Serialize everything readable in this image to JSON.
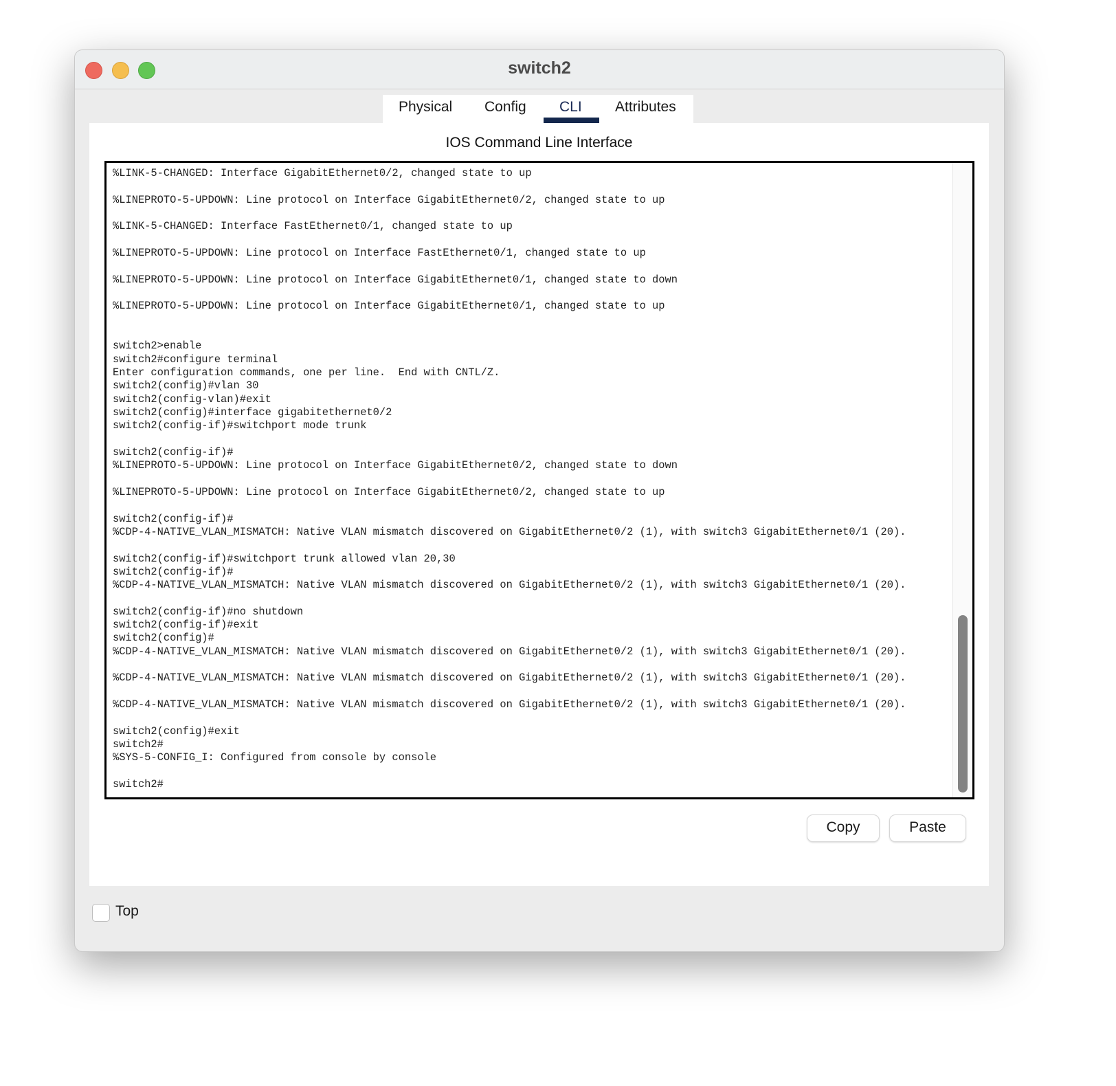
{
  "window": {
    "title": "switch2"
  },
  "tabs": [
    {
      "label": "Physical",
      "active": false
    },
    {
      "label": "Config",
      "active": false
    },
    {
      "label": "CLI",
      "active": true
    },
    {
      "label": "Attributes",
      "active": false
    }
  ],
  "accent_color": "#13274d",
  "cli": {
    "heading": "IOS Command Line Interface",
    "scroll_position_percent": 100,
    "lines": [
      "%LINK-5-CHANGED: Interface GigabitEthernet0/2, changed state to up",
      "",
      "%LINEPROTO-5-UPDOWN: Line protocol on Interface GigabitEthernet0/2, changed state to up",
      "",
      "%LINK-5-CHANGED: Interface FastEthernet0/1, changed state to up",
      "",
      "%LINEPROTO-5-UPDOWN: Line protocol on Interface FastEthernet0/1, changed state to up",
      "",
      "%LINEPROTO-5-UPDOWN: Line protocol on Interface GigabitEthernet0/1, changed state to down",
      "",
      "%LINEPROTO-5-UPDOWN: Line protocol on Interface GigabitEthernet0/1, changed state to up",
      "",
      "",
      "switch2>enable",
      "switch2#configure terminal",
      "Enter configuration commands, one per line.  End with CNTL/Z.",
      "switch2(config)#vlan 30",
      "switch2(config-vlan)#exit",
      "switch2(config)#interface gigabitethernet0/2",
      "switch2(config-if)#switchport mode trunk",
      "",
      "switch2(config-if)#",
      "%LINEPROTO-5-UPDOWN: Line protocol on Interface GigabitEthernet0/2, changed state to down",
      "",
      "%LINEPROTO-5-UPDOWN: Line protocol on Interface GigabitEthernet0/2, changed state to up",
      "",
      "switch2(config-if)#",
      "%CDP-4-NATIVE_VLAN_MISMATCH: Native VLAN mismatch discovered on GigabitEthernet0/2 (1), with switch3 GigabitEthernet0/1 (20).",
      "",
      "switch2(config-if)#switchport trunk allowed vlan 20,30",
      "switch2(config-if)#",
      "%CDP-4-NATIVE_VLAN_MISMATCH: Native VLAN mismatch discovered on GigabitEthernet0/2 (1), with switch3 GigabitEthernet0/1 (20).",
      "",
      "switch2(config-if)#no shutdown",
      "switch2(config-if)#exit",
      "switch2(config)#",
      "%CDP-4-NATIVE_VLAN_MISMATCH: Native VLAN mismatch discovered on GigabitEthernet0/2 (1), with switch3 GigabitEthernet0/1 (20).",
      "",
      "%CDP-4-NATIVE_VLAN_MISMATCH: Native VLAN mismatch discovered on GigabitEthernet0/2 (1), with switch3 GigabitEthernet0/1 (20).",
      "",
      "%CDP-4-NATIVE_VLAN_MISMATCH: Native VLAN mismatch discovered on GigabitEthernet0/2 (1), with switch3 GigabitEthernet0/1 (20).",
      "",
      "switch2(config)#exit",
      "switch2#",
      "%SYS-5-CONFIG_I: Configured from console by console",
      "",
      "switch2#"
    ]
  },
  "buttons": {
    "copy": "Copy",
    "paste": "Paste"
  },
  "footer": {
    "top_checkbox_label": "Top",
    "top_checked": false
  }
}
